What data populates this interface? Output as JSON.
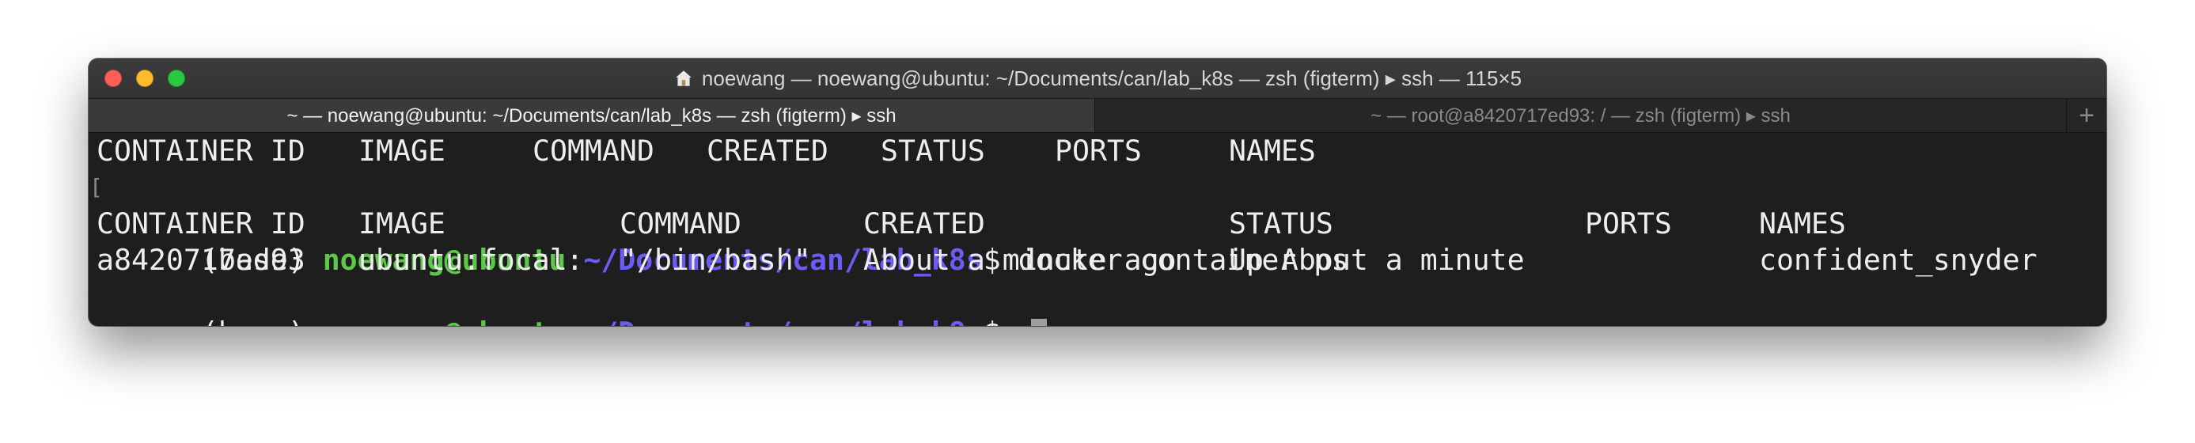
{
  "window": {
    "title": "noewang — noewang@ubuntu: ~/Documents/can/lab_k8s — zsh (figterm) ▸ ssh — 115×5"
  },
  "tabs": [
    {
      "label": "~ — noewang@ubuntu: ~/Documents/can/lab_k8s — zsh (figterm) ▸ ssh",
      "active": true
    },
    {
      "label": "~ — root@a8420717ed93: / — zsh (figterm) ▸ ssh",
      "active": false
    }
  ],
  "tab_add_label": "+",
  "terminal": {
    "header1": {
      "container_id": "CONTAINER ID",
      "image": "IMAGE",
      "command": "COMMAND",
      "created": "CREATED",
      "status": "STATUS",
      "ports": "PORTS",
      "names": "NAMES"
    },
    "prompt1": {
      "env": "(base) ",
      "user_host": "noewang@ubuntu",
      "sep": ":",
      "path": "~/Documents/can/lab_k8s",
      "symbol": "$ ",
      "command": "docker container ps"
    },
    "header2": {
      "container_id": "CONTAINER ID",
      "image": "IMAGE",
      "command": "COMMAND",
      "created": "CREATED",
      "status": "STATUS",
      "ports": "PORTS",
      "names": "NAMES"
    },
    "row": {
      "container_id": "a8420717ed93",
      "image": "ubuntu:focal",
      "command": "\"/bin/bash\"",
      "created": "About a minute ago",
      "status": "Up About a minute",
      "ports": "",
      "names": "confident_snyder"
    },
    "prompt2": {
      "env": "(base) ",
      "user_host": "noewang@ubuntu",
      "sep": ":",
      "path": "~/Documents/can/lab_k8s",
      "symbol": "$ "
    },
    "colors": {
      "user": "#5ec84b",
      "path": "#6a5cf5",
      "text": "#eeeeee",
      "background": "#1e1e1e"
    }
  }
}
